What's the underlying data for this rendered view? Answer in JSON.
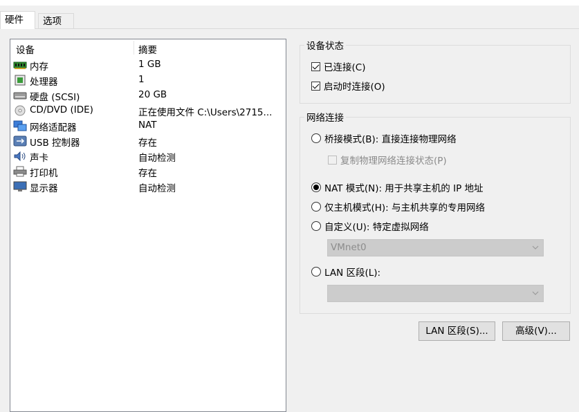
{
  "tabs": [
    {
      "label": "硬件",
      "active": true
    },
    {
      "label": "选项",
      "active": false
    }
  ],
  "device_list": {
    "columns": [
      "设备",
      "摘要"
    ],
    "rows": [
      {
        "icon": "memory-icon",
        "name": "内存",
        "summary": "1 GB"
      },
      {
        "icon": "processor-icon",
        "name": "处理器",
        "summary": "1"
      },
      {
        "icon": "hard-disk-icon",
        "name": "硬盘 (SCSI)",
        "summary": "20 GB"
      },
      {
        "icon": "cd-dvd-icon",
        "name": "CD/DVD (IDE)",
        "summary": "正在使用文件 C:\\Users\\2715..."
      },
      {
        "icon": "network-adapter-icon",
        "name": "网络适配器",
        "summary": "NAT"
      },
      {
        "icon": "usb-icon",
        "name": "USB 控制器",
        "summary": "存在"
      },
      {
        "icon": "sound-card-icon",
        "name": "声卡",
        "summary": "自动检测"
      },
      {
        "icon": "printer-icon",
        "name": "打印机",
        "summary": "存在"
      },
      {
        "icon": "display-icon",
        "name": "显示器",
        "summary": "自动检测"
      }
    ]
  },
  "device_status": {
    "title": "设备状态",
    "connected": {
      "label": "已连接(C)",
      "checked": true
    },
    "connect_at_power_on": {
      "label": "启动时连接(O)",
      "checked": true
    }
  },
  "network_connection": {
    "title": "网络连接",
    "bridged": {
      "label": "桥接模式(B): 直接连接物理网络",
      "selected": false
    },
    "replicate_state": {
      "label": "复制物理网络连接状态(P)",
      "checked": false,
      "enabled": false
    },
    "nat": {
      "label": "NAT 模式(N): 用于共享主机的 IP 地址",
      "selected": true
    },
    "host_only": {
      "label": "仅主机模式(H): 与主机共享的专用网络",
      "selected": false
    },
    "custom": {
      "label": "自定义(U): 特定虚拟网络",
      "selected": false
    },
    "custom_select_value": "VMnet0",
    "lan_segment": {
      "label": "LAN 区段(L):",
      "selected": false
    },
    "lan_segment_select_value": ""
  },
  "buttons": {
    "lan_segments": "LAN 区段(S)...",
    "advanced": "高级(V)..."
  }
}
